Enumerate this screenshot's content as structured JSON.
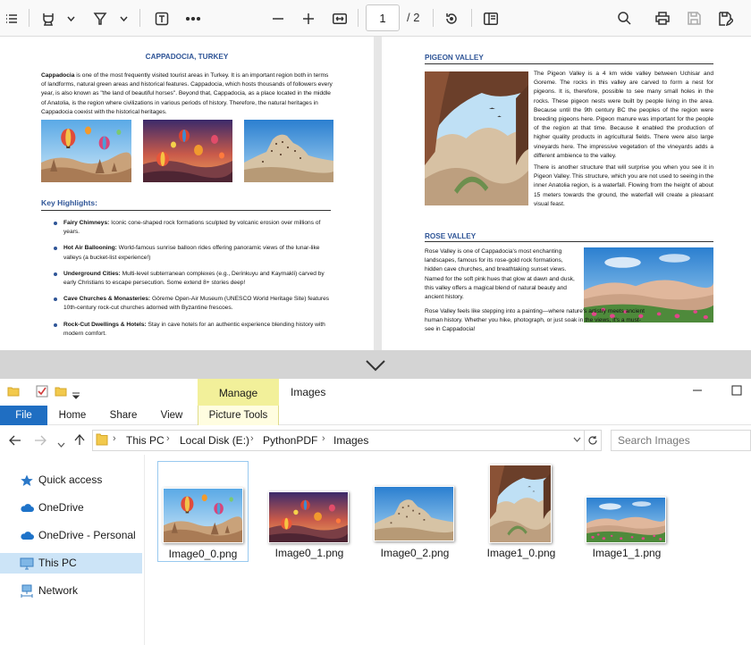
{
  "pdf_viewer": {
    "toolbar": {
      "page_current": "1",
      "page_total": "/ 2"
    },
    "page1": {
      "title": "CAPPADOCIA, TURKEY",
      "intro_bold": "Cappadocia",
      "intro_rest": " is one of the most frequently visited tourist areas in Turkey. It is an important region both in terms of landforms, natural green areas and historical features. Cappadocia, which hosts thousands of followers every year, is also known as \"the land of beautiful horses\". Beyond that, Cappadocia, as a place located in the middle of Anatolia, is the region where civilizations in various periods of history. Therefore, the natural heritages in Cappadocia coexist with the historical heritages.",
      "highlights_title": "Key Highlights:",
      "highlights": [
        {
          "name": "Fairy Chimneys:",
          "text": " Iconic cone-shaped rock formations sculpted by volcanic erosion over millions of years."
        },
        {
          "name": "Hot Air Ballooning:",
          "text": " World-famous sunrise balloon rides offering panoramic views of the lunar-like valleys (a bucket-list experience!)"
        },
        {
          "name": "Underground Cities:",
          "text": " Multi-level subterranean complexes (e.g., Derinkuyu and Kaymakli) carved by early Christians to escape persecution. Some extend 8+ stories deep!"
        },
        {
          "name": "Cave Churches & Monasteries:",
          "text": " Göreme Open-Air Museum (UNESCO World Heritage Site) features 10th-century rock-cut churches adorned with Byzantine frescoes."
        },
        {
          "name": "Rock-Cut Dwellings & Hotels:",
          "text": " Stay in cave hotels for an authentic experience blending history with modern comfort."
        }
      ]
    },
    "page2": {
      "pigeon_title": "PIGEON VALLEY",
      "pigeon_p1": "The Pigeon Valley is a 4 km wide valley between Uchisar and Goreme. The rocks in this valley are carved to form a nest for pigeons. It is, therefore, possible to see many small holes in the rocks. These pigeon nests were built by people living in the area. Because until the 9th century BC the peoples of the region were breeding pigeons here. Pigeon manure was important for the people of the region at that time. Because it enabled the production of higher quality products in agricultural fields. There were also large vineyards here. The impressive vegetation of the vineyards adds a different ambience to the valley.",
      "pigeon_p2": "There is another structure that will surprise you when you see it in Pigeon Valley. This structure, which you are not used to seeing in the inner Anatolia region, is a waterfall. Flowing from the height of about 15 meters towards the ground, the waterfall will create a pleasant visual feast.",
      "rose_title": "ROSE VALLEY",
      "rose_p1": "Rose Valley is one of Cappadocia's most enchanting landscapes, famous for its rose-gold rock formations, hidden cave churches, and breathtaking sunset views. Named for the soft pink hues that glow at dawn and dusk, this valley offers a magical blend of natural beauty and ancient history.",
      "rose_p2": "Rose Valley feels like stepping into a painting—where nature's artistry meets ancient human history. Whether you hike, photograph, or just soak in the views, it's a must-see in Cappadocia!"
    }
  },
  "explorer": {
    "ribbon": {
      "manage": "Manage",
      "context_title": "Images",
      "tabs": [
        "File",
        "Home",
        "Share",
        "View"
      ],
      "picture_tools": "Picture Tools"
    },
    "address": {
      "crumbs": [
        "This PC",
        "Local Disk (E:)",
        "PythonPDF",
        "Images"
      ]
    },
    "search_placeholder": "Search Images",
    "nav": [
      "Quick access",
      "OneDrive",
      "OneDrive - Personal",
      "This PC",
      "Network"
    ],
    "files": [
      "Image0_0.png",
      "Image0_1.png",
      "Image0_2.png",
      "Image1_0.png",
      "Image1_1.png"
    ],
    "colors": {
      "accent": "#1f6ec2",
      "manage_tab": "#f2f09a",
      "selection": "#cce4f7",
      "heading_blue": "#2f5597"
    }
  }
}
